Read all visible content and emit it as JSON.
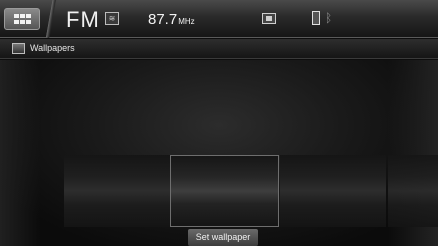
{
  "status_bar": {
    "home_icon": "grid-icon",
    "band": "FM",
    "rds_icon": "rds-icon",
    "frequency": "87.7",
    "frequency_unit": "MHz",
    "screen_icon": "display-icon",
    "usb_icon": "usb-icon",
    "bluetooth_icon": "bluetooth-icon"
  },
  "titlebar": {
    "title": "Wallpapers",
    "icon": "wallpaper-icon"
  },
  "gallery": {
    "items": [
      "wallpaper-1",
      "wallpaper-2",
      "wallpaper-3",
      "wallpaper-4"
    ],
    "selected_index": 1
  },
  "actions": {
    "set_wallpaper": "Set wallpaper"
  }
}
